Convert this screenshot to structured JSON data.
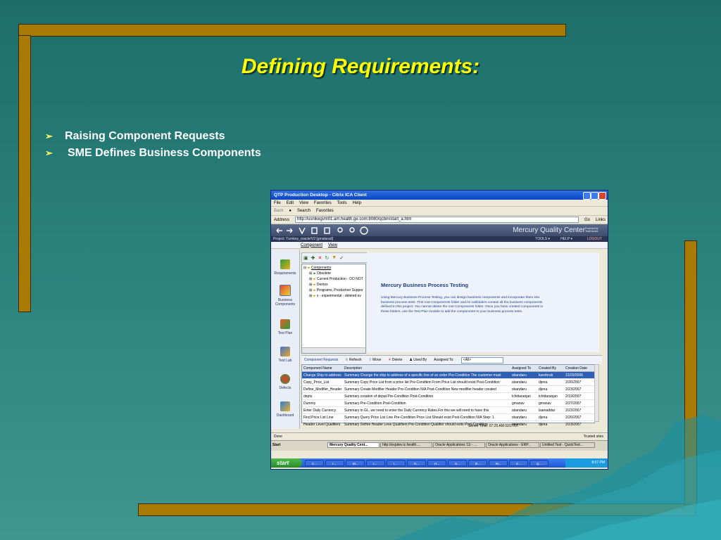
{
  "slide": {
    "title": "Defining Requirements:",
    "bullets": [
      "Raising Component Requests",
      "SME Defines Business Components"
    ],
    "bullet_marker": "➢",
    "colors": {
      "frame": "#a97b05",
      "title": "#ffff00",
      "background": "#1d6e6a"
    }
  },
  "window": {
    "title": "QTP Production Desktop - Citrix ICA Client",
    "menu": [
      "File",
      "Edit",
      "View",
      "Favorites",
      "Tools",
      "Help"
    ],
    "toolbar": {
      "back": "Back",
      "search": "Search",
      "favorites": "Favorites"
    },
    "address_label": "Address",
    "address_value": "http://usnikegvm01.am.health.ge.com:8080/qcbin/start_a.htm",
    "go_label": "Go",
    "links_label": "Links"
  },
  "app": {
    "brand": "Mercury Quality Center",
    "brand_small": "Powered by TestDirector",
    "project": "Project: Turnkey_oracle/V2 [gmalarad]",
    "top_menu": [
      "TOOLS ▾",
      "HELP ▾",
      "LOGOUT"
    ],
    "module_menu": [
      "Component",
      "View"
    ],
    "sidebar": [
      "Requirements",
      "Business Components",
      "Test Plan",
      "Test Lab",
      "Defects",
      "Dashboard"
    ],
    "tree": {
      "root": "Components",
      "children": [
        "Obsolete",
        "Current Production - DO NOT",
        "Demos",
        "Programs, Production Suppor",
        "x - experimental - deleted ev"
      ]
    },
    "info": {
      "heading": "Mercury Business Process Testing",
      "body": "Using Mercury Business Process Testing, you can design business components and incorporate them into business process tests. This root Components folder and its subfolders contain all the business components defined in this project. You cannot delete the root Components folder. Once you have created components in these folders, use the Test Plan module to add the components to your business process tests."
    },
    "requests_bar": {
      "label": "Component Requests",
      "refresh": "Refresh",
      "move": "Move",
      "delete": "Delete",
      "used_by": "Used By",
      "assigned_to_label": "Assigned To:",
      "assigned_to_value": "<All>"
    },
    "grid": {
      "columns": [
        "Component Name",
        "Description",
        "Assigned To",
        "Created By",
        "Creation Date"
      ],
      "rows": [
        [
          "Change Ship to address",
          "Summary   Change the ship to address of a specific line of an order Pre-Condition   The customer must",
          "sbandaru",
          "ksevbrub",
          "12/20/2006"
        ],
        [
          "Copy_Price_List",
          "Summary   Copy Price List from a price list   Pre-Condition   From Price List should exist   Post-Condition",
          "sbandaru",
          "djena",
          "2/26/2007"
        ],
        [
          "Define_Modifier_Header",
          "Summary   Create Modifier Header   Pre-Condition   N/A   Post-Condition   New modifier header created",
          "sbandaru",
          "djena",
          "2/23/2007"
        ],
        [
          "depts",
          "Summary   creation of depat   Pre-Condition   Post-Condition",
          "lchittaranjan",
          "lchittaranjan",
          "2/19/2007"
        ],
        [
          "Dummy",
          "Summary   Pre-Condition   Post-Condition",
          "gmanav",
          "gmanav",
          "2/27/2007"
        ],
        [
          "Enter Daily Currency",
          "Summary   in GL, we need to enter the Daily Currency Rates.For this we will need to have this",
          "sbandaru",
          "lsamaddar",
          "2/22/2007"
        ],
        [
          "Find Price List Line",
          "Summary   Query Price List Line   Pre-Condition Price List Should exist   Post-Condition N/A   Step: 1",
          "sbandaru",
          "djena",
          "2/26/2007"
        ],
        [
          "Header Level Qualifiers",
          "Summary   Define Header Leve Qualifiers   Pre-Condition   Qualifier should exits   Post-Condition",
          "sbandaru",
          "djena",
          "2/23/2007"
        ]
      ]
    },
    "server_time": "Server Time: 07:25 AM 02/27/07"
  },
  "status": {
    "left": "Done",
    "right": "Trusted sites"
  },
  "inner_taskbar": {
    "start": "Start",
    "items": [
      "Mercury Quality Cent...",
      "http://expdev.ic.health....",
      "Oracle Applications 11i - ...",
      "Oracle Applications - ERP...",
      "Untitled Test - QuickTest..."
    ]
  },
  "outer_taskbar": {
    "start": "start",
    "items": [
      "C...",
      "I...",
      "M...",
      "I...",
      "I...",
      "H...",
      "H...",
      "S...",
      "B...",
      "M...",
      "3...",
      "Q..."
    ],
    "clock": "8:57 PM"
  }
}
